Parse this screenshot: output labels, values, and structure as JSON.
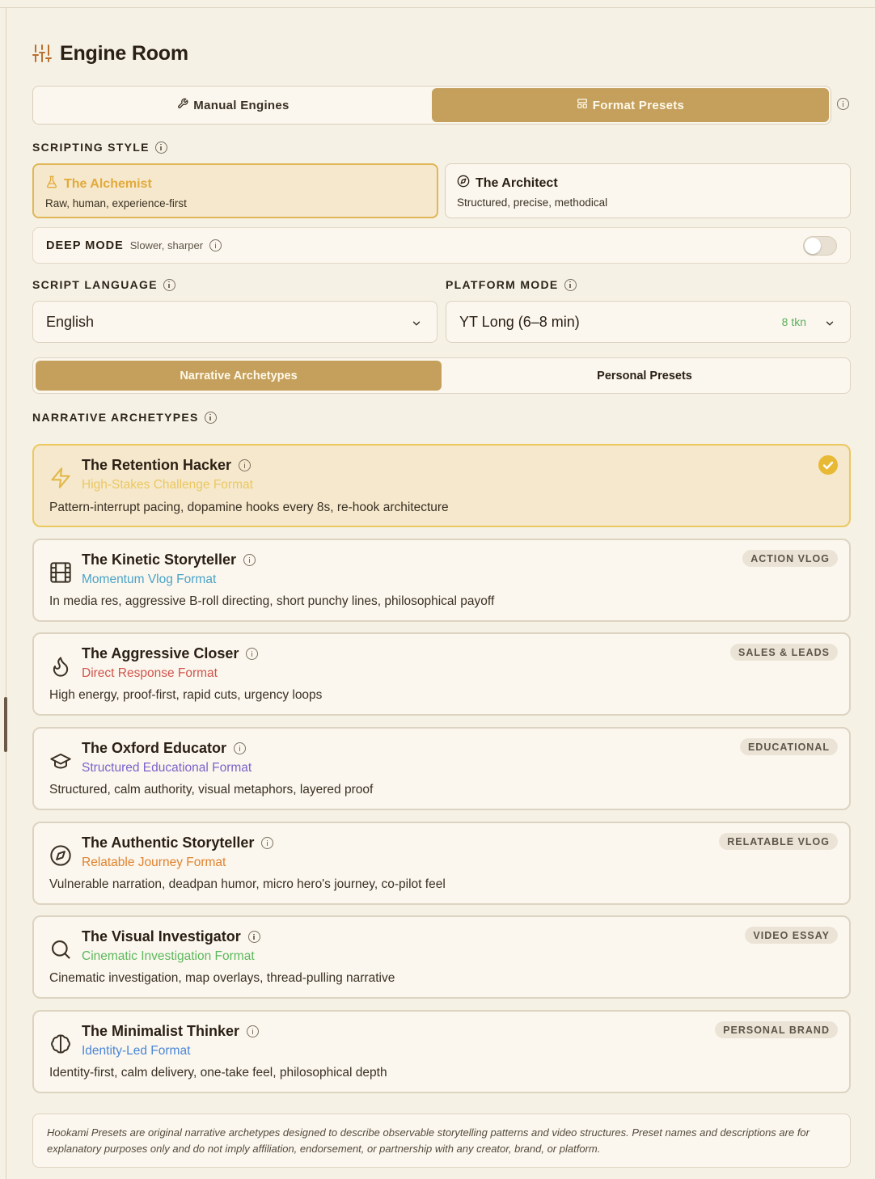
{
  "header": {
    "title": "Engine Room",
    "icon": "sliders-icon"
  },
  "mode_tabs": [
    {
      "label": "Manual Engines",
      "icon": "wrench-icon",
      "active": false
    },
    {
      "label": "Format Presets",
      "icon": "layout-icon",
      "active": true
    }
  ],
  "scripting_style": {
    "label": "SCRIPTING STYLE",
    "options": [
      {
        "title": "The Alchemist",
        "desc": "Raw, human, experience-first",
        "icon": "flask-icon",
        "active": true
      },
      {
        "title": "The Architect",
        "desc": "Structured, precise, methodical",
        "icon": "compass-icon",
        "active": false
      }
    ]
  },
  "deep_mode": {
    "title": "DEEP MODE",
    "subtitle": "Slower, sharper",
    "enabled": false
  },
  "script_language": {
    "label": "SCRIPT LANGUAGE",
    "value": "English"
  },
  "platform_mode": {
    "label": "PLATFORM MODE",
    "value": "YT Long (6–8 min)",
    "tokens": "8 tkn"
  },
  "sub_tabs": [
    {
      "label": "Narrative Archetypes",
      "active": true
    },
    {
      "label": "Personal Presets",
      "active": false
    }
  ],
  "archetypes_label": "NARRATIVE ARCHETYPES",
  "archetypes": [
    {
      "title": "The Retention Hacker",
      "format": "High-Stakes Challenge Format",
      "format_color": "#ecc860",
      "desc": "Pattern-interrupt pacing, dopamine hooks every 8s, re-hook architecture",
      "badge": "",
      "icon": "lightning-icon",
      "selected": true
    },
    {
      "title": "The Kinetic Storyteller",
      "format": "Momentum Vlog Format",
      "format_color": "#4aa3c7",
      "desc": "In media res, aggressive B-roll directing, short punchy lines, philosophical payoff",
      "badge": "ACTION VLOG",
      "icon": "film-icon",
      "selected": false
    },
    {
      "title": "The Aggressive Closer",
      "format": "Direct Response Format",
      "format_color": "#d0544d",
      "desc": "High energy, proof-first, rapid cuts, urgency loops",
      "badge": "SALES & LEADS",
      "icon": "flame-icon",
      "selected": false
    },
    {
      "title": "The Oxford Educator",
      "format": "Structured Educational Format",
      "format_color": "#7c62c9",
      "desc": "Structured, calm authority, visual metaphors, layered proof",
      "badge": "EDUCATIONAL",
      "icon": "graduation-cap-icon",
      "selected": false
    },
    {
      "title": "The Authentic Storyteller",
      "format": "Relatable Journey Format",
      "format_color": "#e0822e",
      "desc": "Vulnerable narration, deadpan humor, micro hero's journey, co-pilot feel",
      "badge": "RELATABLE VLOG",
      "icon": "compass-icon",
      "selected": false
    },
    {
      "title": "The Visual Investigator",
      "format": "Cinematic Investigation Format",
      "format_color": "#5cb85c",
      "desc": "Cinematic investigation, map overlays, thread-pulling narrative",
      "badge": "VIDEO ESSAY",
      "icon": "search-icon",
      "selected": false
    },
    {
      "title": "The Minimalist Thinker",
      "format": "Identity-Led Format",
      "format_color": "#4a86d6",
      "desc": "Identity-first, calm delivery, one-take feel, philosophical depth",
      "badge": "PERSONAL BRAND",
      "icon": "brain-icon",
      "selected": false
    }
  ],
  "disclaimer": "Hookami Presets are original narrative archetypes designed to describe observable storytelling patterns and video structures. Preset names and descriptions are for explanatory purposes only and do not imply affiliation, endorsement, or partnership with any creator, brand, or platform."
}
